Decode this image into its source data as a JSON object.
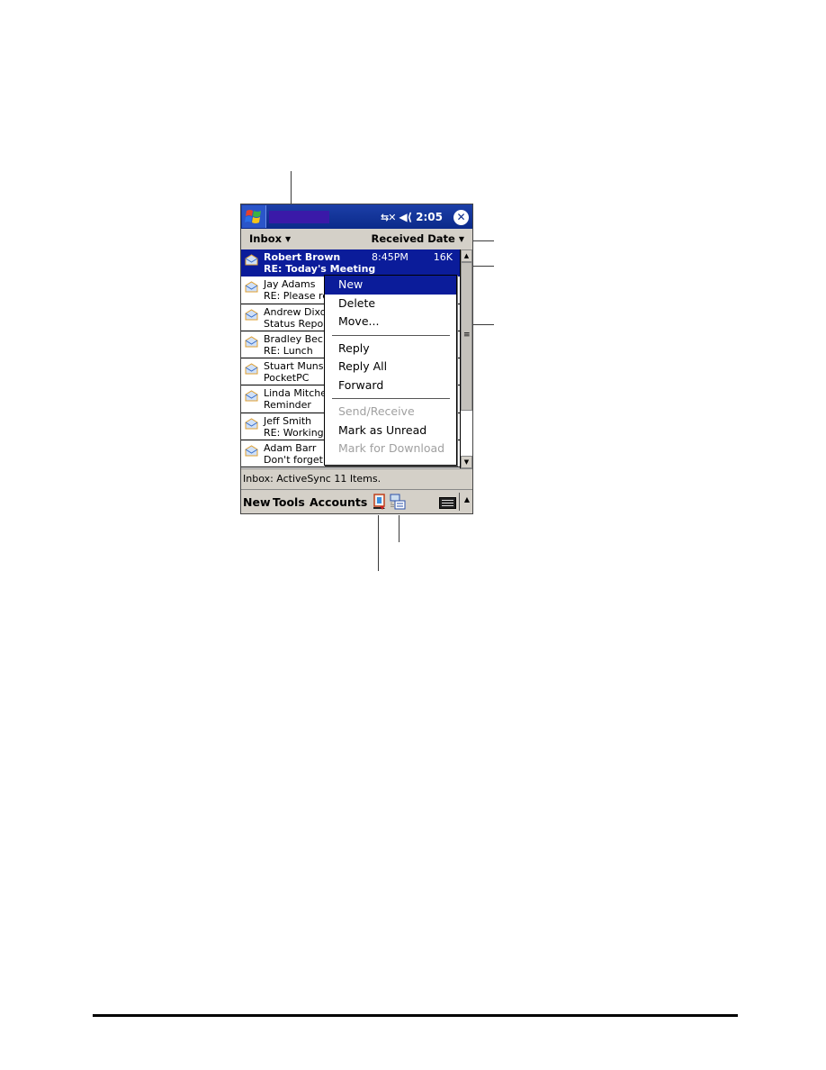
{
  "device": {
    "title_bar": {
      "start_icon": "windows-flag-icon",
      "title_text": "",
      "connectivity_icon": "connectivity-icon",
      "volume_icon": "speaker-icon",
      "time": "2:05",
      "close_icon": "close-icon"
    },
    "sort_bar": {
      "folder": "Inbox",
      "sort_by": "Received Date"
    },
    "messages": [
      {
        "sender": "Robert Brown",
        "subject": "RE: Today's Meeting",
        "time": "8:45PM",
        "size": "16K",
        "selected": true
      },
      {
        "sender": "Jay Adams",
        "subject": "RE: Please re"
      },
      {
        "sender": "Andrew Dixo",
        "subject": "Status Repor"
      },
      {
        "sender": "Bradley Beck",
        "subject": "RE: Lunch"
      },
      {
        "sender": "Stuart Munso",
        "subject": "PocketPC"
      },
      {
        "sender": "Linda Mitchel",
        "subject": "Reminder"
      },
      {
        "sender": "Jeff Smith",
        "subject": "RE: Working"
      },
      {
        "sender": "Adam Barr",
        "subject": "Don't forget"
      }
    ],
    "context_menu": {
      "groups": [
        [
          {
            "label": "New",
            "state": "highlighted"
          },
          {
            "label": "Delete",
            "state": "enabled"
          },
          {
            "label": "Move...",
            "state": "enabled"
          }
        ],
        [
          {
            "label": "Reply",
            "state": "enabled"
          },
          {
            "label": "Reply All",
            "state": "enabled"
          },
          {
            "label": "Forward",
            "state": "enabled"
          }
        ],
        [
          {
            "label": "Send/Receive",
            "state": "disabled"
          },
          {
            "label": "Mark as Unread",
            "state": "enabled"
          },
          {
            "label": "Mark for Download",
            "state": "disabled"
          }
        ]
      ]
    },
    "status_bar": "Inbox: ActiveSync  11 Items.",
    "command_bar": {
      "new": "New",
      "tools": "Tools",
      "accounts": "Accounts",
      "icons": [
        "contacts-icon",
        "send-receive-icon",
        "keyboard-icon",
        "sip-arrow-icon"
      ]
    },
    "colors": {
      "title_bar": "#0b2a8a",
      "selection": "#0b1c9a",
      "chrome": "#d4d0c8",
      "disabled_text": "#a0a0a0"
    }
  }
}
